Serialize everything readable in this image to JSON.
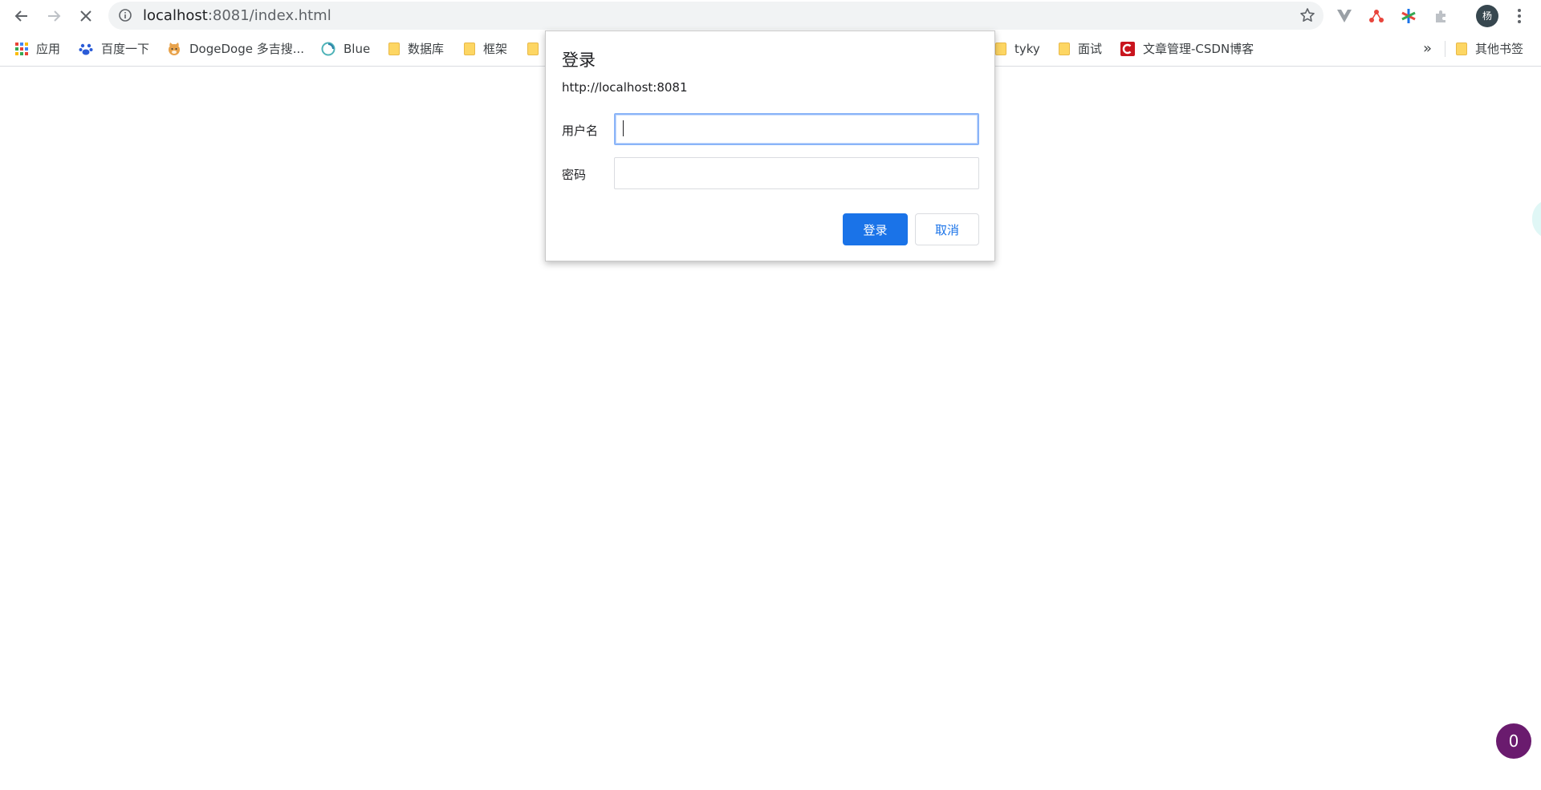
{
  "browser": {
    "url_host": "localhost",
    "url_rest": ":8081/index.html",
    "profile_initial": "杨"
  },
  "bookmarks": [
    {
      "label": "应用",
      "icon": "apps-grid-icon"
    },
    {
      "label": "百度一下",
      "icon": "baidu-paw-icon"
    },
    {
      "label": "DogeDoge 多吉搜...",
      "icon": "doge-icon"
    },
    {
      "label": "Blue",
      "icon": "blue-swirl-icon"
    },
    {
      "label": "数据库",
      "icon": "folder-icon"
    },
    {
      "label": "框架",
      "icon": "folder-icon"
    },
    {
      "label": "tyky",
      "icon": "folder-icon"
    },
    {
      "label": "面试",
      "icon": "folder-icon"
    },
    {
      "label": "文章管理-CSDN博客",
      "icon": "csdn-icon"
    }
  ],
  "bookmarks_overflow": "»",
  "other_bookmarks": "其他书签",
  "dialog": {
    "title": "登录",
    "origin": "http://localhost:8081",
    "username_label": "用户名",
    "username_value": "",
    "password_label": "密码",
    "password_value": "",
    "login_button": "登录",
    "cancel_button": "取消"
  },
  "page": {
    "badge_count": "0"
  },
  "colors": {
    "accent": "#1a73e8",
    "badge": "#6a1b6e",
    "omnibox_bg": "#f1f3f4"
  }
}
